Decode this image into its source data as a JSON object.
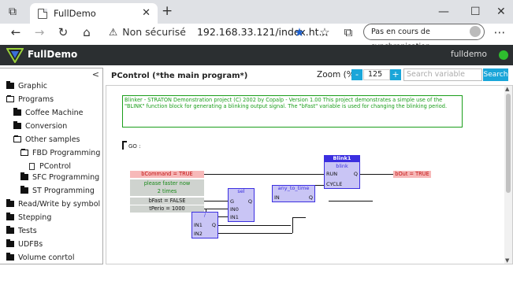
{
  "browser": {
    "tab_title": "FullDemo",
    "security_label": "Non sécurisé",
    "url": "192.168.33.121/index.ht...",
    "sync_label": "Pas en cours de synchronisation"
  },
  "app": {
    "title": "FullDemo",
    "user": "fulldemo",
    "status_color": "#2ebd2e"
  },
  "sidebar": {
    "collapse_label": "<",
    "items": [
      {
        "label": "Graphic",
        "icon": "folder-icon"
      },
      {
        "label": "Programs",
        "icon": "folder-open-icon"
      },
      {
        "label": "Coffee Machine",
        "icon": "folder-icon"
      },
      {
        "label": "Conversion",
        "icon": "folder-icon"
      },
      {
        "label": "Other samples",
        "icon": "folder-open-icon"
      },
      {
        "label": "FBD Programming",
        "icon": "folder-open-icon"
      },
      {
        "label": "PControl",
        "icon": "document-icon"
      },
      {
        "label": "SFC Programming",
        "icon": "folder-icon"
      },
      {
        "label": "ST Programming",
        "icon": "folder-icon"
      },
      {
        "label": "Read/Write by symbol",
        "icon": "folder-icon"
      },
      {
        "label": "Stepping",
        "icon": "folder-icon"
      },
      {
        "label": "Tests",
        "icon": "folder-icon"
      },
      {
        "label": "UDFBs",
        "icon": "folder-icon"
      },
      {
        "label": "Volume conrtol",
        "icon": "folder-icon"
      }
    ]
  },
  "main": {
    "program_title": "PControl (*the main program*)",
    "zoom_label": "Zoom (%)",
    "zoom_minus": "-",
    "zoom_value": "125",
    "zoom_plus": "+",
    "search_placeholder": "Search variable",
    "search_button": "Search"
  },
  "diagram": {
    "comment": "Blinker - STRATON Demonstration project (C) 2002 by Copalp - Version 1.00 This project demonstrates a simple use of the \"BLINK\" function block for generating a blinking output signal. The \"bFast\" variable is used for changing the blinking period.",
    "label": "GO :",
    "blink_block": {
      "name": "Blink1",
      "type": "blink",
      "in1": "RUN",
      "in2": "CYCLE",
      "out": "Q"
    },
    "sel_block": {
      "type": "sel",
      "in1": "G",
      "in2": "IN0",
      "in3": "IN1",
      "out": "Q"
    },
    "time_block": {
      "type": "any_to_time",
      "in1": "IN",
      "out": "Q"
    },
    "div_block": {
      "type": "/",
      "in1": "IN1",
      "in2": "IN2",
      "out": "Q"
    },
    "vars": {
      "bCommand": "bCommand = TRUE",
      "msg1": "please faster now",
      "msg2": "2 times",
      "bFast": "bFast = FALSE",
      "tPerio": "tPerio = 1000",
      "bOut": "bOut = TRUE"
    }
  }
}
